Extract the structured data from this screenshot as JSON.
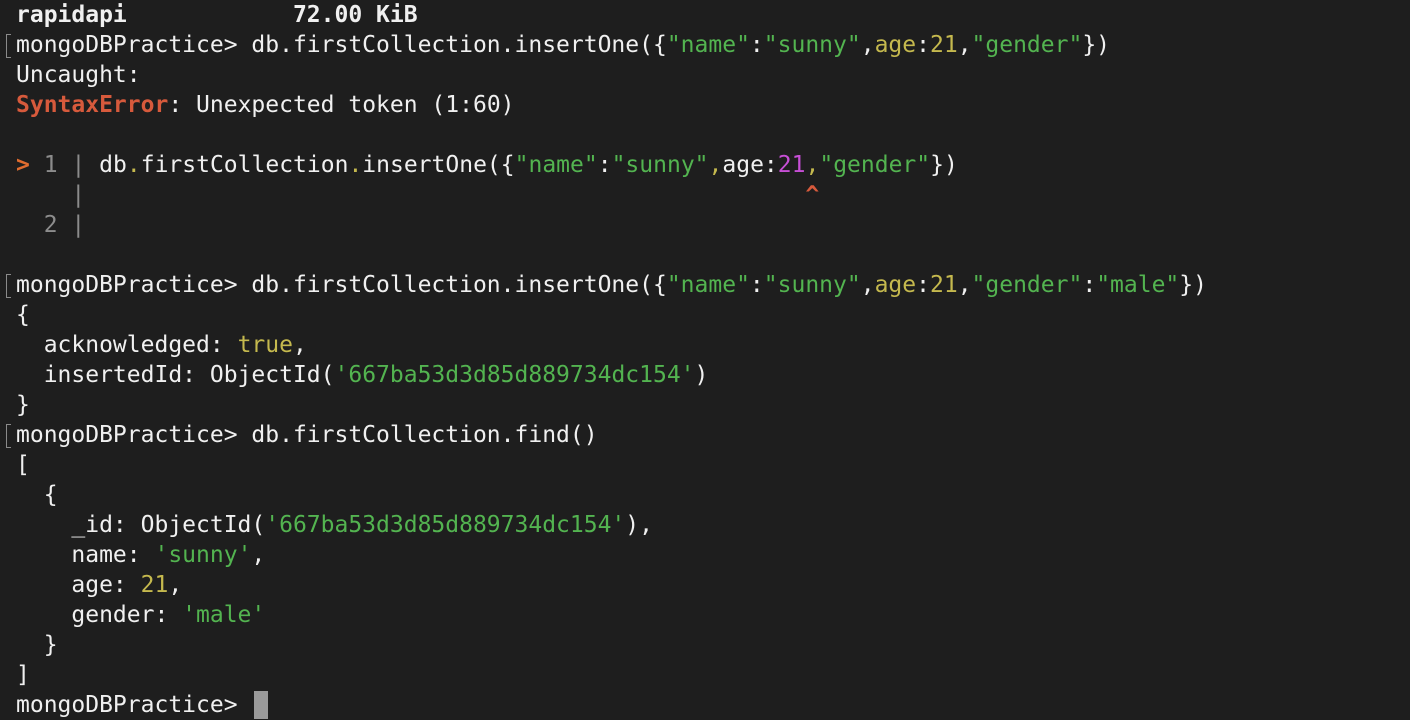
{
  "header": {
    "db_name": "rapidapi",
    "db_size": "72.00 KiB"
  },
  "prompt": "mongoDBPractice> ",
  "cmd1": {
    "p1": "db.firstCollection.insertOne({",
    "k_name": "\"name\"",
    "colon1": ":",
    "v_name": "\"sunny\"",
    "comma1": ",",
    "k_age": "age",
    "colon2": ":",
    "v_age": "21",
    "comma2": ",",
    "k_gender": "\"gender\"",
    "close": "})"
  },
  "error": {
    "uncaught": "Uncaught:",
    "type": "SyntaxError",
    "message": ": Unexpected token (1:60)"
  },
  "snippet": {
    "marker": ">",
    "line1_no": "1",
    "line2_no": "2",
    "sep": "|",
    "code_db": "db",
    "dot1": ".",
    "code_coll": "firstCollection",
    "dot2": ".",
    "code_method": "insertOne",
    "open": "({",
    "k_name": "\"name\"",
    "colon1": ":",
    "v_name": "\"sunny\"",
    "comma1": ",",
    "k_age": "age",
    "colon2": ":",
    "v_age": "21",
    "comma2": ",",
    "k_gender": "\"gender\"",
    "close": "})",
    "caret": "^"
  },
  "cmd2": {
    "p1": "db.firstCollection.insertOne({",
    "k_name": "\"name\"",
    "colon1": ":",
    "v_name": "\"sunny\"",
    "comma1": ",",
    "k_age": "age",
    "colon2": ":",
    "v_age": "21",
    "comma2": ",",
    "k_gender": "\"gender\"",
    "colon3": ":",
    "v_gender": "\"male\"",
    "close": "})"
  },
  "insert_result": {
    "open": "{",
    "ack_key": "  acknowledged: ",
    "ack_val": "true",
    "ack_comma": ",",
    "id_key": "  insertedId: ObjectId(",
    "id_val": "'667ba53d3d85d889734dc154'",
    "id_close": ")",
    "close": "}"
  },
  "cmd3": {
    "text": "db.firstCollection.find()"
  },
  "find_result": {
    "open_arr": "[",
    "open_obj": "  {",
    "id_key": "    _id: ObjectId(",
    "id_val": "'667ba53d3d85d889734dc154'",
    "id_close": "),",
    "name_key": "    name: ",
    "name_val": "'sunny'",
    "name_comma": ",",
    "age_key": "    age: ",
    "age_val": "21",
    "age_comma": ",",
    "gender_key": "    gender: ",
    "gender_val": "'male'",
    "close_obj": "  }",
    "close_arr": "]"
  },
  "colors": {
    "background": "#1e1e1e",
    "text": "#f0f0f0",
    "error": "#d75a3c",
    "string": "#53b450",
    "number": "#c5b94e",
    "number_highlight": "#c74fd6",
    "gutter": "#8c8c8c"
  }
}
